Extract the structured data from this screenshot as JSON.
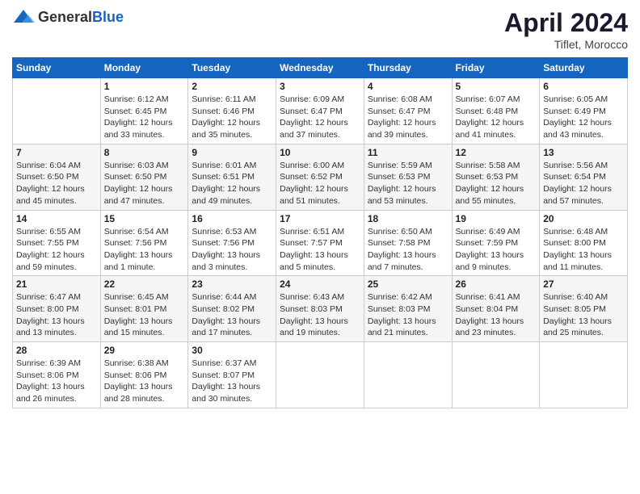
{
  "header": {
    "logo_general": "General",
    "logo_blue": "Blue",
    "main_title": "April 2024",
    "subtitle": "Tiflet, Morocco"
  },
  "weekdays": [
    "Sunday",
    "Monday",
    "Tuesday",
    "Wednesday",
    "Thursday",
    "Friday",
    "Saturday"
  ],
  "weeks": [
    [
      {
        "day": "",
        "info": ""
      },
      {
        "day": "1",
        "info": "Sunrise: 6:12 AM\nSunset: 6:45 PM\nDaylight: 12 hours\nand 33 minutes."
      },
      {
        "day": "2",
        "info": "Sunrise: 6:11 AM\nSunset: 6:46 PM\nDaylight: 12 hours\nand 35 minutes."
      },
      {
        "day": "3",
        "info": "Sunrise: 6:09 AM\nSunset: 6:47 PM\nDaylight: 12 hours\nand 37 minutes."
      },
      {
        "day": "4",
        "info": "Sunrise: 6:08 AM\nSunset: 6:47 PM\nDaylight: 12 hours\nand 39 minutes."
      },
      {
        "day": "5",
        "info": "Sunrise: 6:07 AM\nSunset: 6:48 PM\nDaylight: 12 hours\nand 41 minutes."
      },
      {
        "day": "6",
        "info": "Sunrise: 6:05 AM\nSunset: 6:49 PM\nDaylight: 12 hours\nand 43 minutes."
      }
    ],
    [
      {
        "day": "7",
        "info": "Sunrise: 6:04 AM\nSunset: 6:50 PM\nDaylight: 12 hours\nand 45 minutes."
      },
      {
        "day": "8",
        "info": "Sunrise: 6:03 AM\nSunset: 6:50 PM\nDaylight: 12 hours\nand 47 minutes."
      },
      {
        "day": "9",
        "info": "Sunrise: 6:01 AM\nSunset: 6:51 PM\nDaylight: 12 hours\nand 49 minutes."
      },
      {
        "day": "10",
        "info": "Sunrise: 6:00 AM\nSunset: 6:52 PM\nDaylight: 12 hours\nand 51 minutes."
      },
      {
        "day": "11",
        "info": "Sunrise: 5:59 AM\nSunset: 6:53 PM\nDaylight: 12 hours\nand 53 minutes."
      },
      {
        "day": "12",
        "info": "Sunrise: 5:58 AM\nSunset: 6:53 PM\nDaylight: 12 hours\nand 55 minutes."
      },
      {
        "day": "13",
        "info": "Sunrise: 5:56 AM\nSunset: 6:54 PM\nDaylight: 12 hours\nand 57 minutes."
      }
    ],
    [
      {
        "day": "14",
        "info": "Sunrise: 6:55 AM\nSunset: 7:55 PM\nDaylight: 12 hours\nand 59 minutes."
      },
      {
        "day": "15",
        "info": "Sunrise: 6:54 AM\nSunset: 7:56 PM\nDaylight: 13 hours\nand 1 minute."
      },
      {
        "day": "16",
        "info": "Sunrise: 6:53 AM\nSunset: 7:56 PM\nDaylight: 13 hours\nand 3 minutes."
      },
      {
        "day": "17",
        "info": "Sunrise: 6:51 AM\nSunset: 7:57 PM\nDaylight: 13 hours\nand 5 minutes."
      },
      {
        "day": "18",
        "info": "Sunrise: 6:50 AM\nSunset: 7:58 PM\nDaylight: 13 hours\nand 7 minutes."
      },
      {
        "day": "19",
        "info": "Sunrise: 6:49 AM\nSunset: 7:59 PM\nDaylight: 13 hours\nand 9 minutes."
      },
      {
        "day": "20",
        "info": "Sunrise: 6:48 AM\nSunset: 8:00 PM\nDaylight: 13 hours\nand 11 minutes."
      }
    ],
    [
      {
        "day": "21",
        "info": "Sunrise: 6:47 AM\nSunset: 8:00 PM\nDaylight: 13 hours\nand 13 minutes."
      },
      {
        "day": "22",
        "info": "Sunrise: 6:45 AM\nSunset: 8:01 PM\nDaylight: 13 hours\nand 15 minutes."
      },
      {
        "day": "23",
        "info": "Sunrise: 6:44 AM\nSunset: 8:02 PM\nDaylight: 13 hours\nand 17 minutes."
      },
      {
        "day": "24",
        "info": "Sunrise: 6:43 AM\nSunset: 8:03 PM\nDaylight: 13 hours\nand 19 minutes."
      },
      {
        "day": "25",
        "info": "Sunrise: 6:42 AM\nSunset: 8:03 PM\nDaylight: 13 hours\nand 21 minutes."
      },
      {
        "day": "26",
        "info": "Sunrise: 6:41 AM\nSunset: 8:04 PM\nDaylight: 13 hours\nand 23 minutes."
      },
      {
        "day": "27",
        "info": "Sunrise: 6:40 AM\nSunset: 8:05 PM\nDaylight: 13 hours\nand 25 minutes."
      }
    ],
    [
      {
        "day": "28",
        "info": "Sunrise: 6:39 AM\nSunset: 8:06 PM\nDaylight: 13 hours\nand 26 minutes."
      },
      {
        "day": "29",
        "info": "Sunrise: 6:38 AM\nSunset: 8:06 PM\nDaylight: 13 hours\nand 28 minutes."
      },
      {
        "day": "30",
        "info": "Sunrise: 6:37 AM\nSunset: 8:07 PM\nDaylight: 13 hours\nand 30 minutes."
      },
      {
        "day": "",
        "info": ""
      },
      {
        "day": "",
        "info": ""
      },
      {
        "day": "",
        "info": ""
      },
      {
        "day": "",
        "info": ""
      }
    ]
  ]
}
